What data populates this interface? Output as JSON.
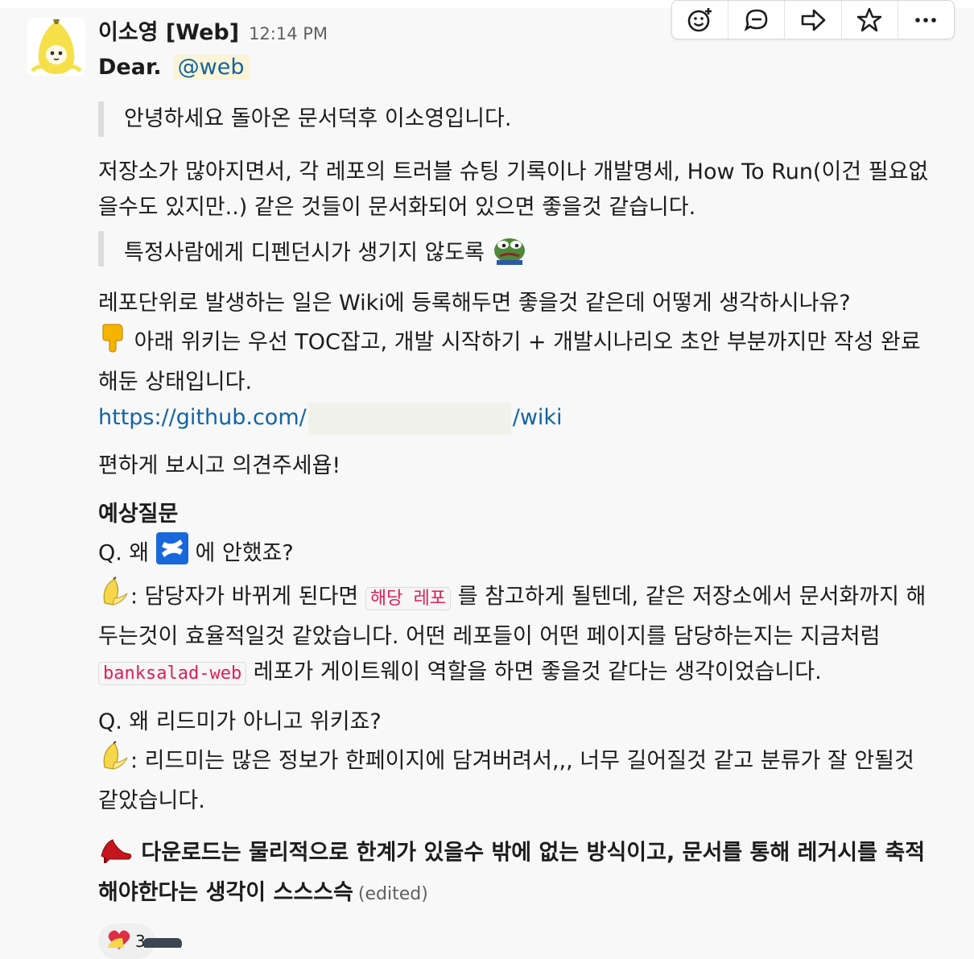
{
  "message": {
    "sender": "이소영 [Web]",
    "time": "12:14 PM",
    "greeting": "Dear.",
    "mention": "@web",
    "quote1": "안녕하세요 돌아온 문서덕후 이소영입니다.",
    "p1_line1": "저장소가 많아지면서, 각 레포의 트러블 슈팅 기록이나 개발명세, How To Run(이건 필요없",
    "p1_line2": "을수도 있지만..) 같은 것들이 문서화되어 있으면 좋을것 같습니다.",
    "quote2": "특정사람에게 디펜던시가 생기지 않도록",
    "p2_line1": "레포단위로 발생하는 일은 Wiki에 등록해두면 좋을것 같은데 어떻게 생각하시나유?",
    "p2_line2": "아래 위키는 우선 TOC잡고, 개발 시작하기 + 개발시나리오 초안 부분까지만 작성 완료",
    "p2_line3": "해둔 상태입니다.",
    "link_start": "https://github.com/",
    "link_end": "/wiki",
    "p3": "편하게 보시고 의견주세욥!",
    "faq_title": "예상질문",
    "q1_pre": "Q. 왜",
    "q1_post": "에 안했죠?",
    "a1_prefix": ": 담당자가 바뀌게 된다면",
    "a1_code": "해당 레포",
    "a1_rest": "를 참고하게 될텐데, 같은 저장소에서 문서화까지 해",
    "a1_line2": "두는것이 효율적일것 같았습니다. 어떤 레포들이 어떤 페이지를 담당하는지는 지금처럼",
    "a1_code2": "banksalad-web",
    "a1_line3_rest": "레포가 게이트웨이 역할을 하면 좋을것 같다는 생각이었습니다.",
    "q2": "Q. 왜 리드미가 아니고 위키죠?",
    "a2_line1": ": 리드미는 많은 정보가 한페이지에 담겨버려서,,, 너무 길어질것 같고 분류가 잘 안될것",
    "a2_line2": "같았습니다.",
    "bold_line1": "다운로드는 물리적으로 한계가 있을수 밖에 없는 방식이고, 문서를 통해 레거시를 축적",
    "bold_line2": "해야한다는 생각이 스스스슥",
    "edited": "(edited)"
  },
  "reactions": [
    {
      "emoji": "heart-icon",
      "count": "3"
    }
  ],
  "toolbar": {
    "icons": [
      "add-reaction-icon",
      "reply-thread-icon",
      "share-icon",
      "star-icon",
      "more-icon"
    ]
  },
  "colors": {
    "link": "#1264a3",
    "code": "#e01e5a",
    "mention_bg": "#fcf4d6",
    "quote_bar": "#dddddd"
  }
}
